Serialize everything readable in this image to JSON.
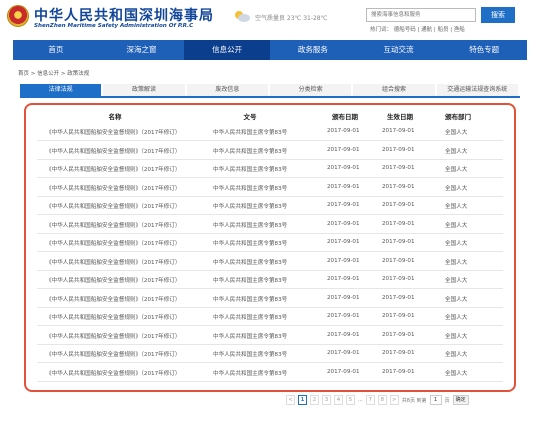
{
  "header": {
    "title_cn": "中华人民共和国深圳海事局",
    "title_en": "ShenZhen Maritime Safety Administration Of P.R.C",
    "weather": "空气质量良  23℃ 31-28℃",
    "search_placeholder": "搜索海事信息和服务",
    "search_label": "搜索",
    "hot_words": "热门词：  德船号码  |  通航  |  船员  |  渔船"
  },
  "nav": {
    "items": [
      "首页",
      "深海之窗",
      "信息公开",
      "政务服务",
      "互动交流",
      "特色专题"
    ]
  },
  "breadcrumb": "首页 > 信息公开 > 政策法规",
  "tabs": [
    "法律法规",
    "政策解读",
    "废改信息",
    "分类检索",
    "组合搜索",
    "交通运输法规查询系统"
  ],
  "table": {
    "headers": [
      "名称",
      "文号",
      "颁布日期",
      "生效日期",
      "颁布部门"
    ],
    "rows": [
      [
        "《中华人民共和国船舶安全监督规则》（2017年修订）",
        "中华人民共和国主席令第83号",
        "2017-09-01",
        "2017-09-01",
        "全国人大"
      ],
      [
        "《中华人民共和国船舶安全监督规则》（2017年修订）",
        "中华人民共和国主席令第83号",
        "2017-09-01",
        "2017-09-01",
        "全国人大"
      ],
      [
        "《中华人民共和国船舶安全监督规则》（2017年修订）",
        "中华人民共和国主席令第83号",
        "2017-09-01",
        "2017-09-01",
        "全国人大"
      ],
      [
        "《中华人民共和国船舶安全监督规则》（2017年修订）",
        "中华人民共和国主席令第83号",
        "2017-09-01",
        "2017-09-01",
        "全国人大"
      ],
      [
        "《中华人民共和国船舶安全监督规则》（2017年修订）",
        "中华人民共和国主席令第83号",
        "2017-09-01",
        "2017-09-01",
        "全国人大"
      ],
      [
        "《中华人民共和国船舶安全监督规则》（2017年修订）",
        "中华人民共和国主席令第83号",
        "2017-09-01",
        "2017-09-01",
        "全国人大"
      ],
      [
        "《中华人民共和国船舶安全监督规则》（2017年修订）",
        "中华人民共和国主席令第83号",
        "2017-09-01",
        "2017-09-01",
        "全国人大"
      ],
      [
        "《中华人民共和国船舶安全监督规则》（2017年修订）",
        "中华人民共和国主席令第83号",
        "2017-09-01",
        "2017-09-01",
        "全国人大"
      ],
      [
        "《中华人民共和国船舶安全监督规则》（2017年修订）",
        "中华人民共和国主席令第83号",
        "2017-09-01",
        "2017-09-01",
        "全国人大"
      ],
      [
        "《中华人民共和国船舶安全监督规则》（2017年修订）",
        "中华人民共和国主席令第83号",
        "2017-09-01",
        "2017-09-01",
        "全国人大"
      ],
      [
        "《中华人民共和国船舶安全监督规则》（2017年修订）",
        "中华人民共和国主席令第83号",
        "2017-09-01",
        "2017-09-01",
        "全国人大"
      ],
      [
        "《中华人民共和国船舶安全监督规则》（2017年修订）",
        "中华人民共和国主席令第83号",
        "2017-09-01",
        "2017-09-01",
        "全国人大"
      ],
      [
        "《中华人民共和国船舶安全监督规则》（2017年修订）",
        "中华人民共和国主席令第83号",
        "2017-09-01",
        "2017-09-01",
        "全国人大"
      ],
      [
        "《中华人民共和国船舶安全监督规则》（2017年修订）",
        "中华人民共和国主席令第83号",
        "2017-09-01",
        "2017-09-01",
        "全国人大"
      ]
    ]
  },
  "pager": {
    "prev": "<",
    "pages": [
      "1",
      "2",
      "3",
      "4",
      "5",
      "...",
      "7",
      "8"
    ],
    "current": "1",
    "next": ">",
    "total_text": "共8页 到第",
    "jump_value": "1",
    "page_unit": "页",
    "go_label": "确定"
  },
  "colors": {
    "brand_blue": "#1e5fb8",
    "nav_active": "#0b3f8e",
    "highlight_border": "#e2523a"
  }
}
